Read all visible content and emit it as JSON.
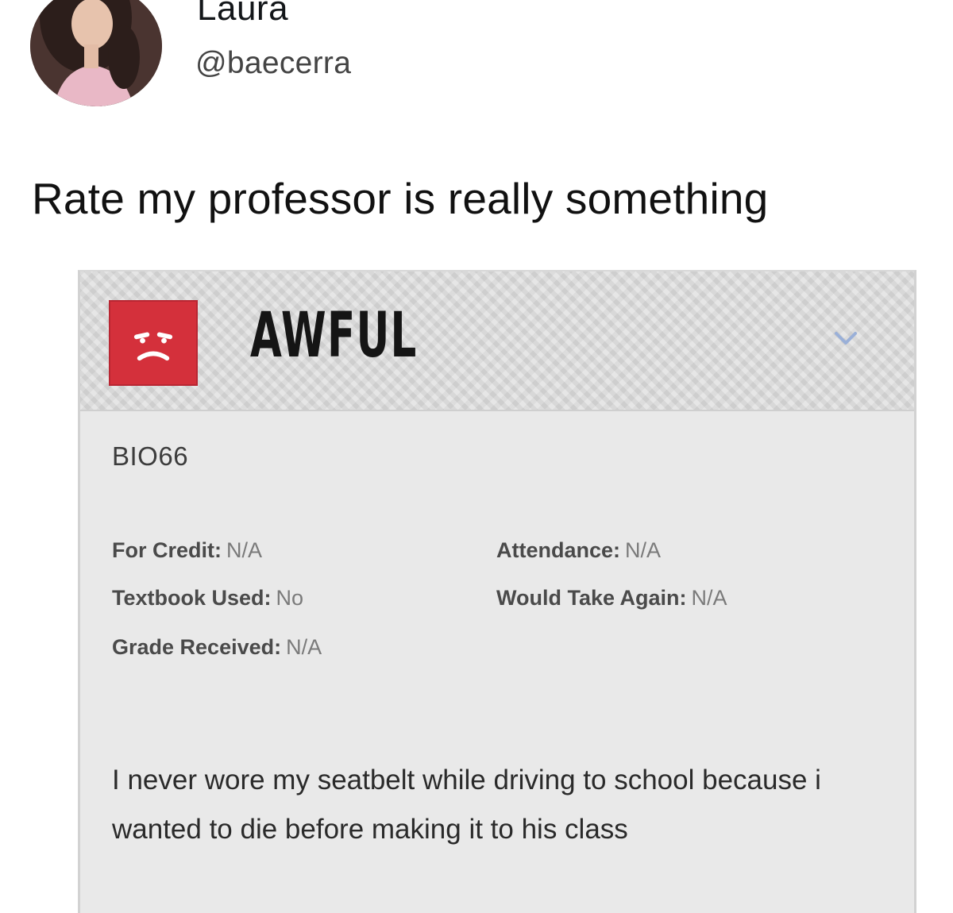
{
  "tweet": {
    "display_name": "Laura",
    "handle": "@baecerra",
    "text": "Rate my professor is really something"
  },
  "review": {
    "rating_label": "AWFUL",
    "rating_color": "#d4303b",
    "rating_icon": "frown-face-icon",
    "expand_icon": "chevron-down-icon",
    "course": "BIO66",
    "details": {
      "for_credit": {
        "label": "For Credit:",
        "value": "N/A"
      },
      "textbook_used": {
        "label": "Textbook Used:",
        "value": "No"
      },
      "grade_received": {
        "label": "Grade Received:",
        "value": "N/A"
      },
      "attendance": {
        "label": "Attendance:",
        "value": "N/A"
      },
      "would_take_again": {
        "label": "Would Take Again:",
        "value": "N/A"
      }
    },
    "comment": "I never wore my seatbelt while driving to school because i wanted to die before making it to his class"
  }
}
